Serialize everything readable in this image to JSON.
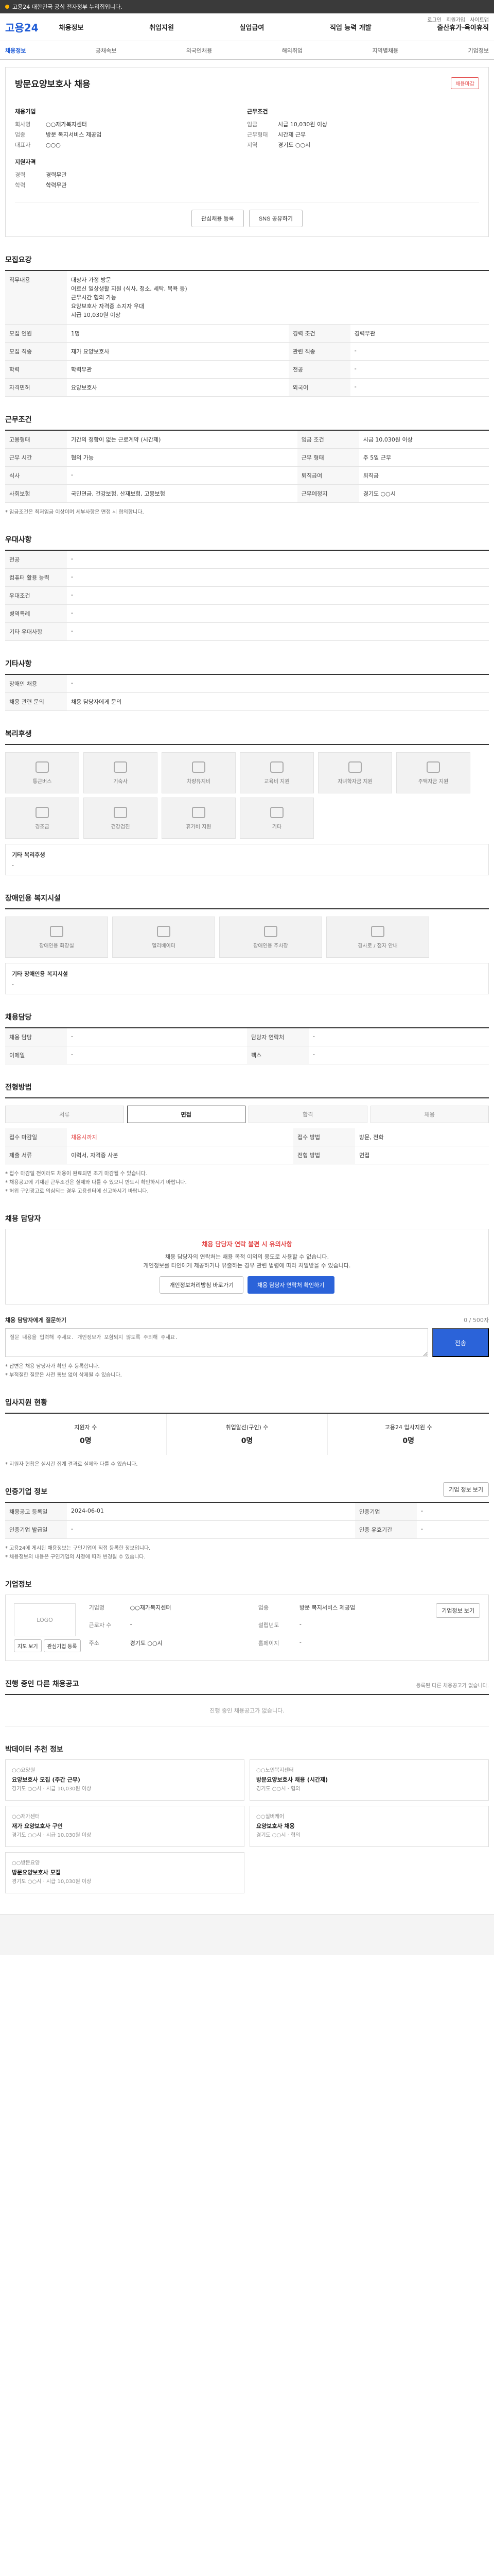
{
  "topbar": {
    "text": "고용24 대한민국 공식 전자정부 누리집입니다."
  },
  "header": {
    "logo": "고용24",
    "nav": [
      "채용정보",
      "취업지원",
      "실업급여",
      "직업 능력 개발",
      "출산휴가·육아휴직"
    ],
    "util": [
      "로그인",
      "회원가입",
      "사이트맵"
    ]
  },
  "subnav": {
    "items": [
      "채용정보",
      "공채속보",
      "외국인채용",
      "해외취업",
      "지역별채용",
      "기업정보"
    ],
    "active": "채용정보"
  },
  "job": {
    "title": "방문요양보호사 채용",
    "badge": "채용마감",
    "company_head": "채용기업",
    "company": [
      {
        "k": "회사명",
        "v": "○○재가복지센터"
      },
      {
        "k": "업종",
        "v": "방문 복지서비스 제공업"
      },
      {
        "k": "대표자",
        "v": "○○○"
      }
    ],
    "cond_head": "근무조건",
    "cond": [
      {
        "k": "임금",
        "v": "시급 10,030원 이상"
      },
      {
        "k": "근무형태",
        "v": "시간제 근무"
      },
      {
        "k": "지역",
        "v": "경기도 ○○시"
      }
    ],
    "req_head": "지원자격",
    "req": [
      {
        "k": "경력",
        "v": "경력무관"
      },
      {
        "k": "학력",
        "v": "학력무관"
      }
    ],
    "buttons": {
      "scrap": "관심채용 등록",
      "share": "SNS 공유하기"
    }
  },
  "summary": {
    "title": "모집요강",
    "desc_label": "직무내용",
    "desc": "대상자 가정 방문\n어르신 일상생활 지원 (식사, 청소, 세탁, 목욕 등)\n근무시간 협의 가능\n요양보호사 자격증 소지자 우대\n시급 10,030원 이상",
    "rows": [
      {
        "k": "모집 인원",
        "v": "1명",
        "k2": "경력 조건",
        "v2": "경력무관"
      },
      {
        "k": "모집 직종",
        "v": "재가 요양보호사",
        "k2": "관련 직종",
        "v2": "-"
      },
      {
        "k": "학력",
        "v": "학력무관",
        "k2": "전공",
        "v2": "-"
      },
      {
        "k": "자격면허",
        "v": "요양보호사",
        "k2": "외국어",
        "v2": "-"
      }
    ]
  },
  "conditions": {
    "title": "근무조건",
    "rows": [
      {
        "k": "고용형태",
        "v": "기간의 정함이 없는 근로계약 (시간제)",
        "k2": "임금 조건",
        "v2": "시급 10,030원 이상"
      },
      {
        "k": "근무 시간",
        "v": "협의 가능",
        "k2": "근무 형태",
        "v2": "주 5일 근무"
      },
      {
        "k": "식사",
        "v": "-",
        "k2": "퇴직급여",
        "v2": "퇴직금"
      },
      {
        "k": "사회보험",
        "v": "국민연금, 건강보험, 산재보험, 고용보험",
        "k2": "근무예정지",
        "v2": "경기도 ○○시"
      }
    ],
    "note": "* 임금조건은 최저임금 이상이며 세부사항은 면접 시 협의합니다."
  },
  "preferences": {
    "title": "우대사항",
    "rows": [
      {
        "k": "전공",
        "v": "-"
      },
      {
        "k": "컴퓨터 활용 능력",
        "v": "-"
      },
      {
        "k": "우대조건",
        "v": "-"
      },
      {
        "k": "병역특례",
        "v": "-"
      },
      {
        "k": "기타 우대사항",
        "v": "-"
      }
    ]
  },
  "other": {
    "title": "기타사항",
    "rows": [
      {
        "k": "장애인 채용",
        "v": "-"
      },
      {
        "k": "채용 관련 문의",
        "v": "채용 담당자에게 문의"
      }
    ]
  },
  "welfare": {
    "title": "복리후생",
    "tiles": [
      "통근버스",
      "기숙사",
      "차량유지비",
      "교육비 지원",
      "자녀학자금 지원",
      "주택자금 지원",
      "경조금",
      "건강검진",
      "휴가비 지원",
      "기타"
    ],
    "note_label": "기타 복리후생",
    "note": "-"
  },
  "facility": {
    "title": "장애인용 복지시설",
    "tiles": [
      "장애인용 화장실",
      "엘리베이터",
      "장애인용 주차장",
      "경사로 / 점자 안내"
    ],
    "note_label": "기타 장애인용 복지시설",
    "note": "-"
  },
  "manager": {
    "title": "채용담당",
    "rows": [
      {
        "k": "채용 담당",
        "v": "-",
        "k2": "담당자 연락처",
        "v2": "-"
      },
      {
        "k": "이메일",
        "v": "-",
        "k2": "팩스",
        "v2": "-"
      }
    ]
  },
  "process": {
    "title": "전형방법",
    "steps": [
      "서류",
      "면접",
      "합격",
      "채용"
    ],
    "active": "면접",
    "items": [
      {
        "k": "접수 마감일",
        "v": "채용시까지",
        "k2": "접수 방법",
        "v2": "방문, 전화"
      },
      {
        "k": "제출 서류",
        "v": "이력서, 자격증 사본",
        "k2": "전형 방법",
        "v2": "면접"
      }
    ],
    "bullets": [
      "* 접수 마감일 전이라도 채용이 완료되면 조기 마감될 수 있습니다.",
      "* 채용공고에 기재된 근무조건은 실제와 다를 수 있으니 반드시 확인하시기 바랍니다.",
      "* 허위 구인광고로 의심되는 경우 고용센터에 신고하시기 바랍니다."
    ]
  },
  "contact": {
    "title": "채용 담당자",
    "alert_head": "채용 담당자 연락 불편 시 유의사항",
    "alert_body": "채용 담당자의 연락처는 채용 목적 이외의 용도로 사용할 수 없습니다.\n개인정보를 타인에게 제공하거나 유출하는 경우 관련 법령에 따라 처벌받을 수 있습니다.",
    "btn1": "개인정보처리방침 바로가기",
    "btn2": "채용 담당자 연락처 확인하기",
    "inquiry_title": "채용 담당자에게 질문하기",
    "inquiry_count": "0 / 500자",
    "inquiry_placeholder": "질문 내용을 입력해 주세요. 개인정보가 포함되지 않도록 주의해 주세요.",
    "inquiry_send": "전송",
    "inquiry_notes": [
      "* 답변은 채용 담당자가 확인 후 등록합니다.",
      "* 부적절한 질문은 사전 통보 없이 삭제될 수 있습니다."
    ]
  },
  "apply_status": {
    "title": "입사지원 현황",
    "stats": [
      {
        "label": "지원자 수",
        "value": "0명"
      },
      {
        "label": "취업알선(구인) 수",
        "value": "0명"
      },
      {
        "label": "고용24 입사지원 수",
        "value": "0명"
      }
    ],
    "note": "* 지원자 현황은 실시간 집계 결과로 실제와 다를 수 있습니다."
  },
  "registration": {
    "title": "인증기업 정보",
    "btn": "기업 정보 보기",
    "rows": [
      {
        "k": "채용공고 등록일",
        "v": "2024-06-01",
        "k2": "인증기업",
        "v2": "-"
      },
      {
        "k": "인증기업 발급일",
        "v": "-",
        "k2": "인증 유효기간",
        "v2": "-"
      }
    ],
    "notes": [
      "* 고용24에 게시된 채용정보는 구인기업이 직접 등록한 정보입니다.",
      "* 채용정보의 내용은 구인기업의 사정에 따라 변경될 수 있습니다."
    ]
  },
  "company_info": {
    "title": "기업정보",
    "logo": "LOGO",
    "btn": "기업정보 보기",
    "fields": [
      {
        "k": "기업명",
        "v": "○○재가복지센터"
      },
      {
        "k": "업종",
        "v": "방문 복지서비스 제공업"
      },
      {
        "k": "근로자 수",
        "v": "-"
      },
      {
        "k": "설립년도",
        "v": "-"
      },
      {
        "k": "주소",
        "v": "경기도 ○○시"
      },
      {
        "k": "홈페이지",
        "v": "-"
      }
    ],
    "actions": [
      "지도 보기",
      "관심기업 등록"
    ]
  },
  "related": {
    "title": "진행 중인 다른 채용공고",
    "note": "등록된 다른 채용공고가 없습니다.",
    "empty": "진행 중인 채용공고가 없습니다."
  },
  "recommend": {
    "title": "박데이터 추천 정보",
    "items": [
      {
        "co": "○○요양원",
        "title": "요양보호사 모집 (주간 근무)",
        "meta": "경기도 ○○시 · 시급 10,030원 이상"
      },
      {
        "co": "○○노인복지센터",
        "title": "방문요양보호사 채용 (시간제)",
        "meta": "경기도 ○○시 · 협의"
      },
      {
        "co": "○○재가센터",
        "title": "재가 요양보호사 구인",
        "meta": "경기도 ○○시 · 시급 10,030원 이상"
      },
      {
        "co": "○○실버케어",
        "title": "요양보호사 채용",
        "meta": "경기도 ○○시 · 협의"
      },
      {
        "co": "○○방문요양",
        "title": "방문요양보호사 모집",
        "meta": "경기도 ○○시 · 시급 10,030원 이상"
      }
    ]
  }
}
